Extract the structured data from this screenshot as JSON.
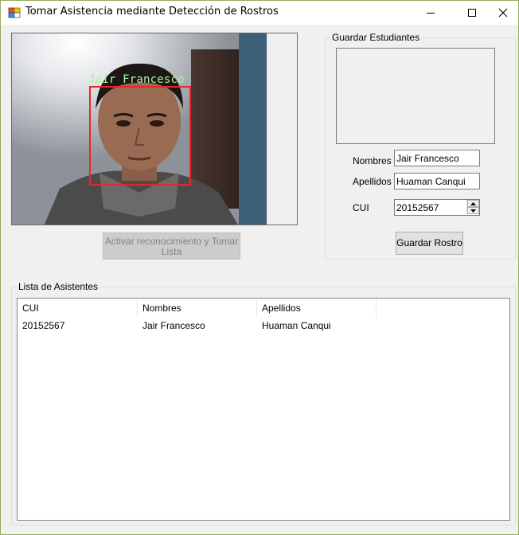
{
  "window": {
    "title": "Tomar Asistencia mediante Detección de Rostros",
    "icons": [
      "app-icon",
      "minimize-icon",
      "maximize-icon",
      "close-icon"
    ]
  },
  "camera": {
    "face_label": "Jair Francesco",
    "box_color": "#e8262a",
    "label_color": "#a8f7a0"
  },
  "buttons": {
    "activar_label": "Activar reconocimiento y Tomar Lista",
    "guardar_label": "Guardar Rostro"
  },
  "guardar_estudiantes": {
    "legend": "Guardar Estudiantes",
    "nombres_label": "Nombres",
    "nombres_value": "Jair Francesco",
    "apellidos_label": "Apellidos",
    "apellidos_value": "Huaman Canqui",
    "cui_label": "CUI",
    "cui_value": "20152567"
  },
  "lista": {
    "legend": "Lista de Asistentes",
    "columns": [
      "CUI",
      "Nombres",
      "Apellidos"
    ],
    "rows": [
      [
        "20152567",
        "Jair Francesco",
        "Huaman Canqui"
      ]
    ]
  }
}
